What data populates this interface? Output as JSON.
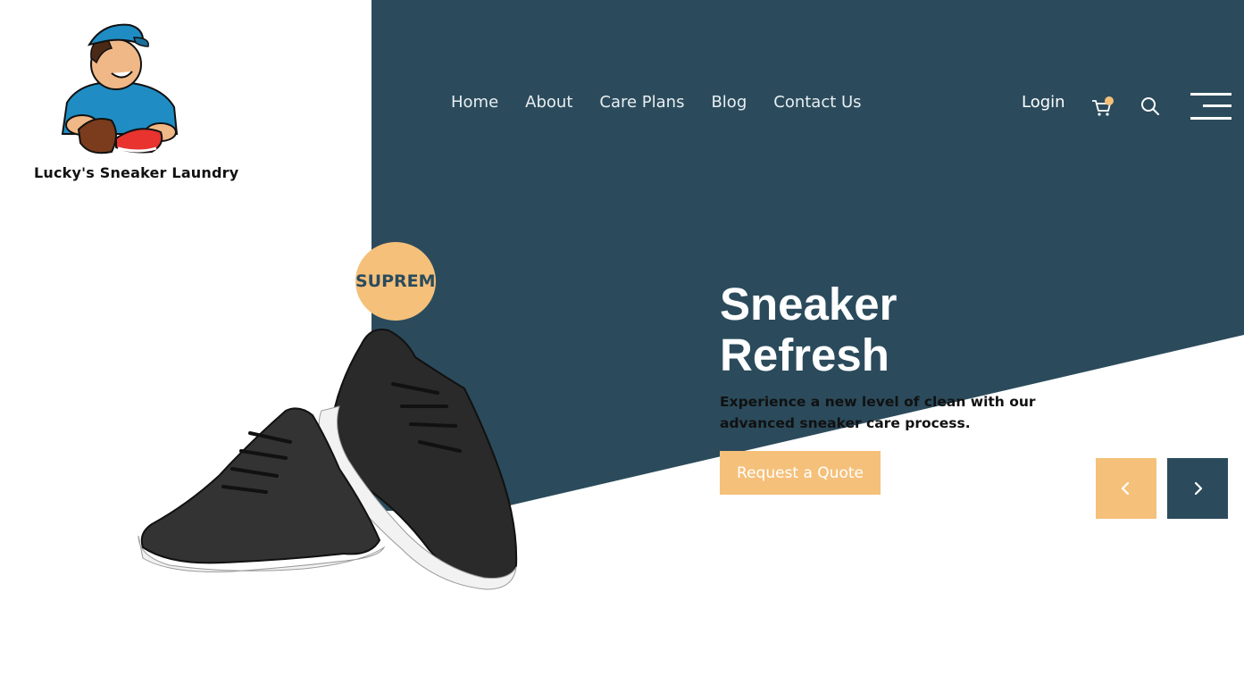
{
  "brand": {
    "name": "Lucky's Sneaker Laundry"
  },
  "nav": {
    "items": [
      "Home",
      "About",
      "Care Plans",
      "Blog",
      "Contact Us"
    ]
  },
  "header": {
    "login_label": "Login",
    "cart_icon": "cart-icon",
    "search_icon": "search-icon",
    "menu_icon": "hamburger-menu-icon"
  },
  "hero": {
    "badge": "SUPREME",
    "title_line1": "Sneaker",
    "title_line2": "Refresh",
    "description": "Experience a new level of clean with our advanced sneaker care process.",
    "cta_label": "Request a Quote"
  },
  "slider": {
    "prev_icon": "chevron-left-icon",
    "next_icon": "chevron-right-icon"
  },
  "colors": {
    "dark_teal": "#2b4b5c",
    "accent_peach": "#f5c07a",
    "white": "#ffffff"
  }
}
